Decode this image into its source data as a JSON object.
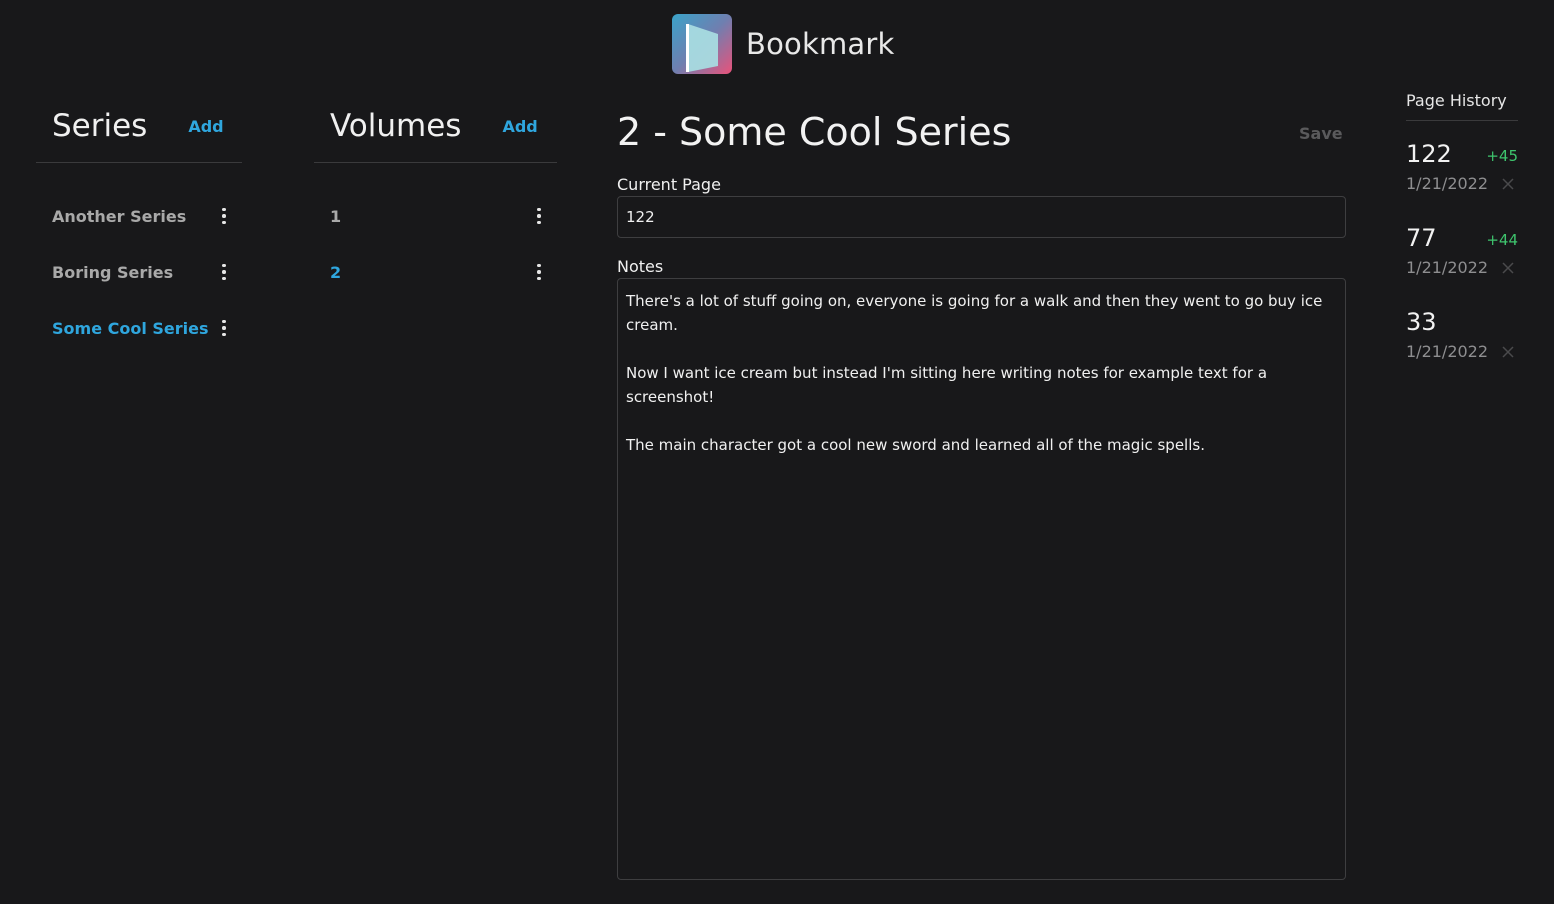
{
  "app": {
    "title": "Bookmark"
  },
  "series": {
    "title": "Series",
    "add_label": "Add",
    "items": [
      {
        "label": "Another Series",
        "active": false
      },
      {
        "label": "Boring Series",
        "active": false
      },
      {
        "label": "Some Cool Series",
        "active": true
      }
    ]
  },
  "volumes": {
    "title": "Volumes",
    "add_label": "Add",
    "items": [
      {
        "label": "1",
        "active": false
      },
      {
        "label": "2",
        "active": true
      }
    ]
  },
  "editor": {
    "title": "2 - Some Cool Series",
    "save_label": "Save",
    "current_page_label": "Current Page",
    "current_page_value": "122",
    "notes_label": "Notes",
    "notes_value": "There's a lot of stuff going on, everyone is going for a walk and then they went to go buy ice cream.\n\nNow I want ice cream but instead I'm sitting here writing notes for example text for a screenshot!\n\nThe main character got a cool new sword and learned all of the magic spells."
  },
  "history": {
    "title": "Page History",
    "entries": [
      {
        "page": "122",
        "delta": "+45",
        "date": "1/21/2022"
      },
      {
        "page": "77",
        "delta": "+44",
        "date": "1/21/2022"
      },
      {
        "page": "33",
        "delta": "",
        "date": "1/21/2022"
      }
    ]
  },
  "colors": {
    "background": "#18181a",
    "accent": "#2fa6de",
    "delta_positive": "#3ec46d",
    "muted": "#a9a9a9"
  },
  "icons": {
    "logo": "bookmark-logo-icon",
    "menu": "kebab-menu-icon",
    "delete": "close-icon"
  }
}
